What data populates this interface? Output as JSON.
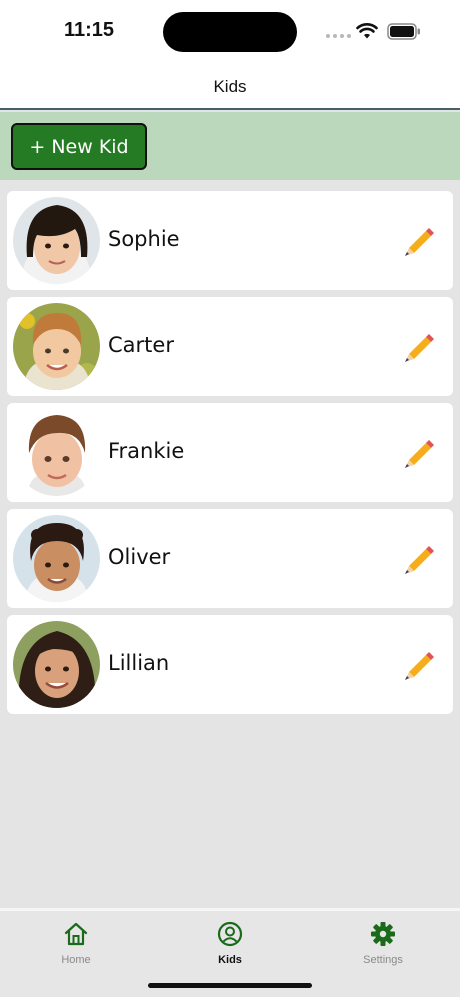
{
  "status_bar": {
    "time": "11:15"
  },
  "nav": {
    "title": "Kids"
  },
  "toolbar": {
    "new_kid_label": "+ New Kid"
  },
  "kids": [
    {
      "name": "Sophie"
    },
    {
      "name": "Carter"
    },
    {
      "name": "Frankie"
    },
    {
      "name": "Oliver"
    },
    {
      "name": "Lillian"
    }
  ],
  "tabs": [
    {
      "label": "Home",
      "icon": "house-icon",
      "active": false
    },
    {
      "label": "Kids",
      "icon": "user-circle-icon",
      "active": true
    },
    {
      "label": "Settings",
      "icon": "gear-icon",
      "active": false
    }
  ],
  "colors": {
    "accent_green": "#257a24",
    "toolbar_bg": "#bcd8bc",
    "tab_active": "#1a6a1a",
    "tab_inactive": "#8a8a8a"
  }
}
